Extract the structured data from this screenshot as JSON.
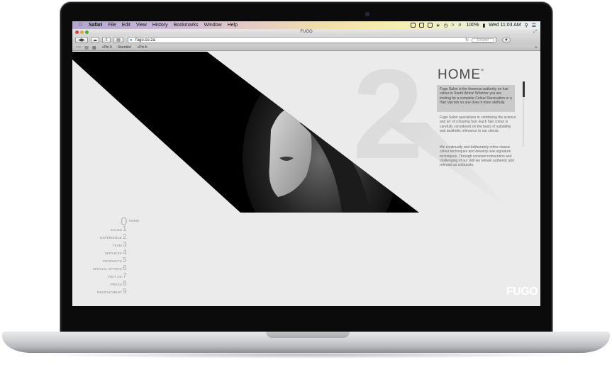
{
  "menubar": {
    "app": "Safari",
    "items": [
      "File",
      "Edit",
      "View",
      "History",
      "Bookmarks",
      "Window",
      "Help"
    ],
    "battery": "100%",
    "clock": "Wed 11:03 AM"
  },
  "window": {
    "title": "FUGO"
  },
  "toolbar": {
    "url": "fugo.co.za",
    "reader_label": "Reader"
  },
  "bookmarks": {
    "items": [
      "«Pin It",
      "Stumble!",
      "«Pin It"
    ]
  },
  "page": {
    "heading": "HOME",
    "intro": "Fugo Salon is the foremost authority on hair colour in South Africa! Whether you are looking for a complete Colour Renovation or a Hair Varnish no one does it more skillfully.",
    "paragraph_1": "Fugo Salon specializes in combining the science and art of colouring hair. Each hair colour is carefully considered on the basis of suitability and aesthetic relevance to our clients.",
    "paragraph_2": "We continually and deliberately refine classic colour techniques and develop new signature techniques. Through constant reinvention and challenging of our skill we remain authentic and relevant as colourists.",
    "logo": "FUGO"
  },
  "nav": [
    {
      "num": "0",
      "label": "HOME"
    },
    {
      "num": "1",
      "label": "SALON"
    },
    {
      "num": "2",
      "label": "EXPERIENCE"
    },
    {
      "num": "3",
      "label": "TEAM"
    },
    {
      "num": "4",
      "label": "SERVICES"
    },
    {
      "num": "5",
      "label": "PRODUCTS"
    },
    {
      "num": "6",
      "label": "SPECIAL OFFERS"
    },
    {
      "num": "7",
      "label": "VISIT US"
    },
    {
      "num": "8",
      "label": "PRESS"
    },
    {
      "num": "9",
      "label": "RECRUITMENT"
    }
  ],
  "colors": {
    "page_background": "#ebebeb",
    "diagonal_band": "#000000",
    "heading": "#4a4a4a"
  }
}
